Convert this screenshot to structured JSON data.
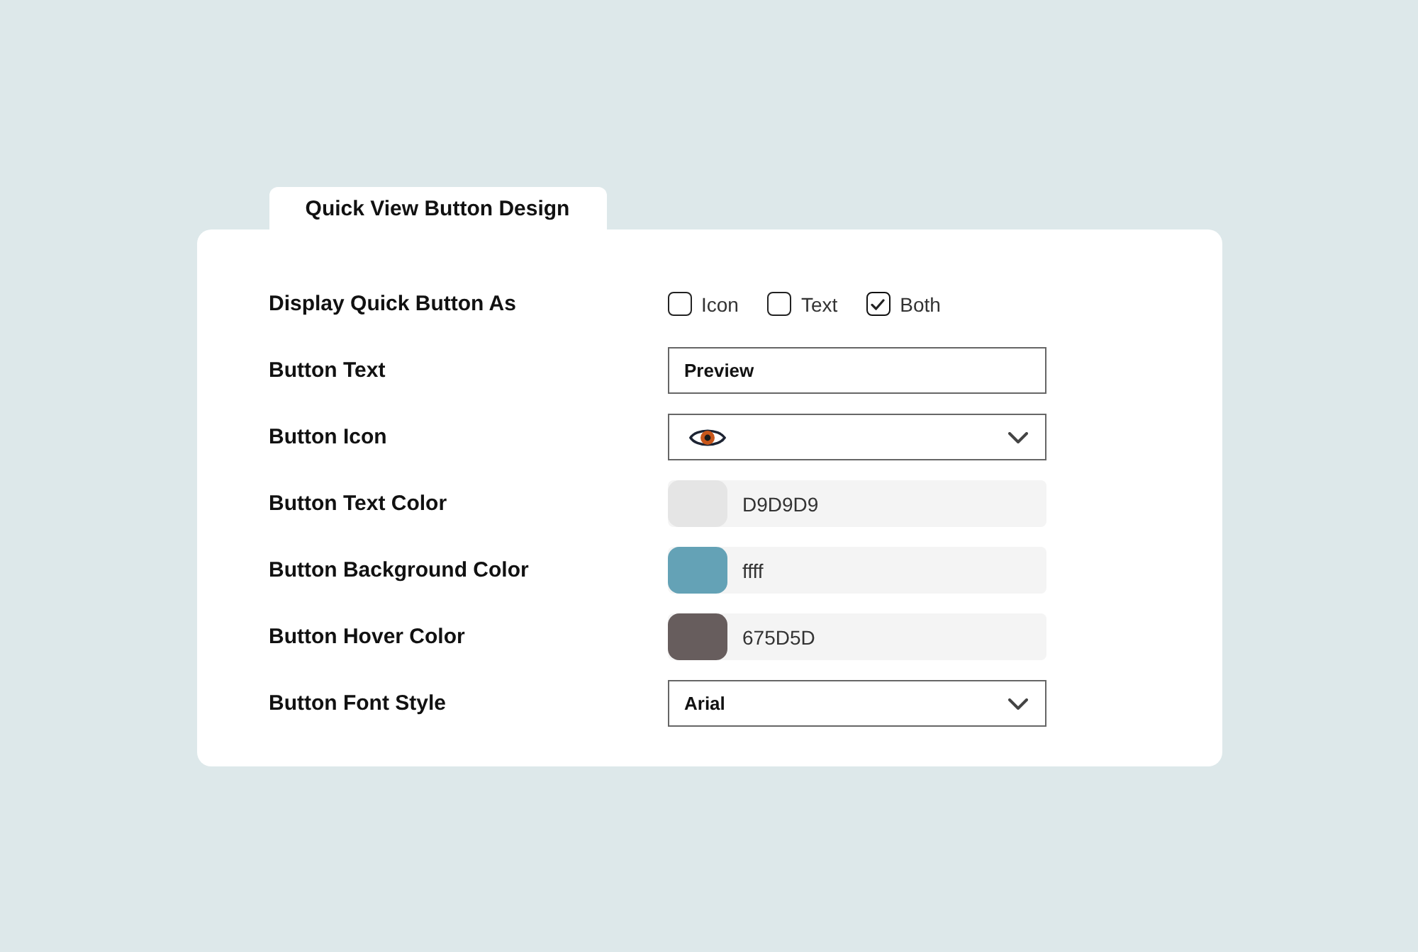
{
  "tab": {
    "title": "Quick View Button Design"
  },
  "settings": [
    {
      "kind": "checkboxes",
      "label": "Display Quick Button As",
      "options": [
        {
          "label": "Icon",
          "checked": false
        },
        {
          "label": "Text",
          "checked": false
        },
        {
          "label": "Both",
          "checked": true
        }
      ]
    },
    {
      "kind": "text",
      "label": "Button Text",
      "value": "Preview"
    },
    {
      "kind": "icon_select",
      "label": "Button Icon"
    },
    {
      "kind": "color",
      "label": "Button Text Color",
      "color": "#e5e5e5",
      "value": "D9D9D9"
    },
    {
      "kind": "color",
      "label": "Button Background Color",
      "color": "#64a2b6",
      "value": "ffff"
    },
    {
      "kind": "color",
      "label": "Button Hover Color",
      "color": "#675d5d",
      "value": "675D5D"
    },
    {
      "kind": "select",
      "label": "Button Font Style",
      "value": "Arial"
    }
  ]
}
